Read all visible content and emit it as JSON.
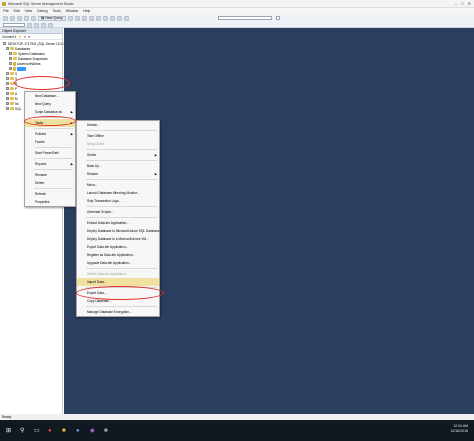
{
  "window": {
    "title": "Microsoft SQL Server Management Studio",
    "controls": [
      "–",
      "□",
      "✕"
    ]
  },
  "menubar": [
    "File",
    "Edit",
    "View",
    "Debug",
    "Tools",
    "Window",
    "Help"
  ],
  "toolbar": {
    "new_query": "New Query"
  },
  "object_explorer": {
    "header": "Object Explorer",
    "connect_label": "Connect ▾",
    "items": [
      {
        "label": "DESKTOP-1717941 (SQL Server 13.0.4001",
        "indent": 1,
        "icon": "server"
      },
      {
        "label": "Databases",
        "indent": 2,
        "icon": "folder"
      },
      {
        "label": "System Databases",
        "indent": 3,
        "icon": "folder"
      },
      {
        "label": "Database Snapshots",
        "indent": 3,
        "icon": "folder"
      },
      {
        "label": "AdventureWorks",
        "indent": 3,
        "icon": "database"
      },
      {
        "label": "testdb",
        "indent": 3,
        "icon": "database",
        "selected": true
      },
      {
        "label": "S",
        "indent": 2,
        "icon": "folder"
      },
      {
        "label": "S",
        "indent": 2,
        "icon": "folder"
      },
      {
        "label": "R",
        "indent": 2,
        "icon": "folder"
      },
      {
        "label": "P",
        "indent": 2,
        "icon": "folder"
      },
      {
        "label": "A",
        "indent": 2,
        "icon": "folder"
      },
      {
        "label": "M",
        "indent": 2,
        "icon": "folder"
      },
      {
        "label": "Int",
        "indent": 2,
        "icon": "folder"
      },
      {
        "label": "SQL",
        "indent": 2,
        "icon": "folder"
      }
    ]
  },
  "context_menu_db": {
    "items": [
      {
        "label": "New Database...",
        "arrow": false
      },
      {
        "label": "New Query",
        "arrow": false
      },
      {
        "label": "Script Database as",
        "arrow": true
      },
      {
        "label": "Tasks",
        "arrow": true,
        "highlight": true
      },
      {
        "label": "Policies",
        "arrow": true
      },
      {
        "label": "Facets",
        "arrow": false
      },
      {
        "label": "Start PowerShell",
        "arrow": false
      },
      {
        "label": "Reports",
        "arrow": true
      },
      {
        "label": "Rename",
        "arrow": false
      },
      {
        "label": "Delete",
        "arrow": false
      },
      {
        "label": "Refresh",
        "arrow": false
      },
      {
        "label": "Properties",
        "arrow": false
      }
    ]
  },
  "context_menu_tasks": {
    "items": [
      {
        "label": "Detach...",
        "arrow": false,
        "dim": false
      },
      {
        "label": "Take Offline",
        "arrow": false,
        "dim": false
      },
      {
        "label": "Bring Online",
        "arrow": false,
        "dim": true
      },
      {
        "label": "Shrink",
        "arrow": true,
        "dim": false
      },
      {
        "label": "Back Up...",
        "arrow": false,
        "dim": false
      },
      {
        "label": "Restore",
        "arrow": true,
        "dim": false
      },
      {
        "label": "Mirror...",
        "arrow": false,
        "dim": false
      },
      {
        "label": "Launch Database Mirroring Monitor...",
        "arrow": false,
        "dim": false
      },
      {
        "label": "Ship Transaction Logs...",
        "arrow": false,
        "dim": false
      },
      {
        "label": "Generate Scripts...",
        "arrow": false,
        "dim": false
      },
      {
        "label": "Extract Data-tier Application...",
        "arrow": false,
        "dim": false
      },
      {
        "label": "Deploy Database to Microsoft Azure SQL Database...",
        "arrow": false,
        "dim": false
      },
      {
        "label": "Deploy Database to a Microsoft Azure VM...",
        "arrow": false,
        "dim": false
      },
      {
        "label": "Export Data-tier Application...",
        "arrow": false,
        "dim": false
      },
      {
        "label": "Register as Data-tier Application...",
        "arrow": false,
        "dim": false
      },
      {
        "label": "Upgrade Data-tier Application...",
        "arrow": false,
        "dim": false
      },
      {
        "label": "Delete Data-tier Application...",
        "arrow": false,
        "dim": true
      },
      {
        "label": "Import Data...",
        "arrow": false,
        "dim": false,
        "highlight": true
      },
      {
        "label": "Export Data...",
        "arrow": false,
        "dim": false
      },
      {
        "label": "Copy Database...",
        "arrow": false,
        "dim": false
      },
      {
        "label": "Manage Database Encryption...",
        "arrow": false,
        "dim": false
      }
    ]
  },
  "status_bar": {
    "text": "Ready"
  },
  "taskbar": {
    "clock_time": "12:04 AM",
    "clock_date": "12/18/2016"
  },
  "colors": {
    "client_bg": "#2c3e5e",
    "selection": "#3399ff",
    "annotation": "#e0302a"
  }
}
